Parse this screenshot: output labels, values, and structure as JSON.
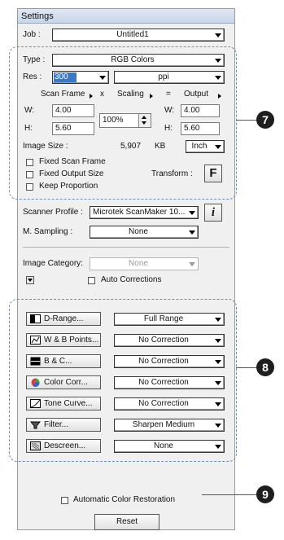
{
  "window": {
    "title": "Settings"
  },
  "job": {
    "label": "Job :",
    "value": "Untitled1"
  },
  "type": {
    "label": "Type :",
    "value": "RGB Colors"
  },
  "res": {
    "label": "Res :",
    "value": "300",
    "unit": "ppi"
  },
  "scan": {
    "scan_frame": "Scan Frame",
    "x": "x",
    "scaling": "Scaling",
    "eq": "=",
    "output": "Output",
    "w_label": "W:",
    "h_label": "H:",
    "w_in": "4.00",
    "h_in": "5.60",
    "scale": "100%",
    "w_out": "4.00",
    "h_out": "5.60"
  },
  "image_size": {
    "label": "Image Size :",
    "value": "5,907",
    "unit": "KB",
    "display_unit": "Inch"
  },
  "options": {
    "fixed_scan_frame": "Fixed Scan Frame",
    "fixed_output_size": "Fixed Output Size",
    "keep_proportion": "Keep Proportion",
    "transform": "Transform :",
    "transform_icon": "F"
  },
  "scanner_profile": {
    "label": "Scanner Profile :",
    "value": "Microtek ScanMaker 10..."
  },
  "sampling": {
    "label": "M. Sampling :",
    "value": "None"
  },
  "image_category": {
    "label": "Image Category:",
    "value": "None"
  },
  "auto_corrections": {
    "label": "Auto Corrections"
  },
  "tools": [
    {
      "label": "D-Range...",
      "value": "Full Range"
    },
    {
      "label": "W & B Points...",
      "value": "No Correction"
    },
    {
      "label": "B & C...",
      "value": "No Correction"
    },
    {
      "label": "Color Corr...",
      "value": "No Correction"
    },
    {
      "label": "Tone Curve...",
      "value": "No Correction"
    },
    {
      "label": "Filter...",
      "value": "Sharpen Medium"
    },
    {
      "label": "Descreen...",
      "value": "None"
    }
  ],
  "auto_color": {
    "label": "Automatic Color Restoration"
  },
  "reset": {
    "label": "Reset"
  },
  "callouts": [
    "7",
    "8",
    "9"
  ],
  "colors": {
    "callout_line": "#2a5ea8",
    "badge": "#1e1e1e",
    "dashed": "#6c8fb8",
    "selection": "#3a78c8"
  }
}
